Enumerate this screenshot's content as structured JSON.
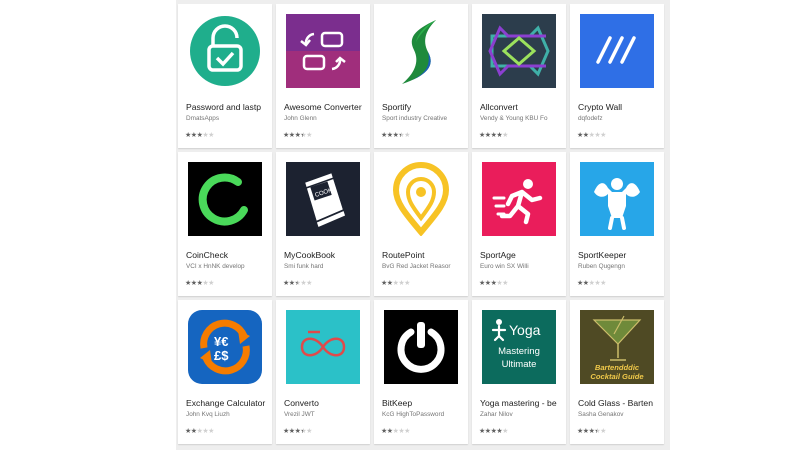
{
  "apps": [
    {
      "title": "Password and lastp",
      "developer": "DmatsApps",
      "rating": 3,
      "icon": "padlock-check-icon",
      "bg": "#ffffff"
    },
    {
      "title": "Awesome Converter",
      "developer": "John Glenn",
      "rating": 3.5,
      "icon": "convert-arrows-icon",
      "bg": "#6a2c83"
    },
    {
      "title": "Sportify",
      "developer": "Sport industry Creative",
      "rating": 3.5,
      "icon": "s-swoosh-icon",
      "bg": "#ffffff"
    },
    {
      "title": "Allconvert",
      "developer": "Vendy & Young KBU Fo",
      "rating": 4,
      "icon": "double-arrows-icon",
      "bg": "#2d3e4d"
    },
    {
      "title": "Crypto Wall",
      "developer": "dqfodefz",
      "rating": 2,
      "icon": "slashes-icon",
      "bg": "#2f73e9"
    },
    {
      "title": "CoinCheck",
      "developer": "VCI x HnNK develop",
      "rating": 3,
      "icon": "loading-ring-icon",
      "bg": "#000000"
    },
    {
      "title": "MyCookBook",
      "developer": "Smi funk hard",
      "rating": 2.5,
      "icon": "cookbook-icon",
      "bg": "#1e2430"
    },
    {
      "title": "RoutePoint",
      "developer": "BvG Red Jacket Reasor",
      "rating": 2,
      "icon": "map-pin-icon",
      "bg": "#ffffff"
    },
    {
      "title": "SportAge",
      "developer": "Euro win SX Willi",
      "rating": 3,
      "icon": "runner-icon",
      "bg": "#ea1d5b"
    },
    {
      "title": "SportKeeper",
      "developer": "Ruben Qugengn",
      "rating": 2,
      "icon": "muscle-man-icon",
      "bg": "#25a5e8"
    },
    {
      "title": "Exchange Calculator",
      "developer": "John Kvq Liuzh",
      "rating": 2,
      "icon": "currency-exchange-icon",
      "bg": "#ffffff"
    },
    {
      "title": "Converto",
      "developer": "Vrezil JWT",
      "rating": 3.5,
      "icon": "infinity-loop-icon",
      "bg": "#2ac0c6"
    },
    {
      "title": "BitKeep",
      "developer": "KcG HighToPassword",
      "rating": 2,
      "icon": "power-ring-icon",
      "bg": "#000000"
    },
    {
      "title": "Yoga mastering - be",
      "developer": "Zahar Nilov",
      "rating": 4,
      "icon": "yoga-icon",
      "bg": "#0e6b5e",
      "icon_text": [
        "Yoga",
        "Mastering",
        "Ultimate"
      ]
    },
    {
      "title": "Cold Glass - Barten",
      "developer": "Sasha Genakov",
      "rating": 3.5,
      "icon": "cocktail-glass-icon",
      "bg": "#4f4a24",
      "icon_text": [
        "Bartendddic",
        "Cocktail Guide"
      ]
    }
  ]
}
